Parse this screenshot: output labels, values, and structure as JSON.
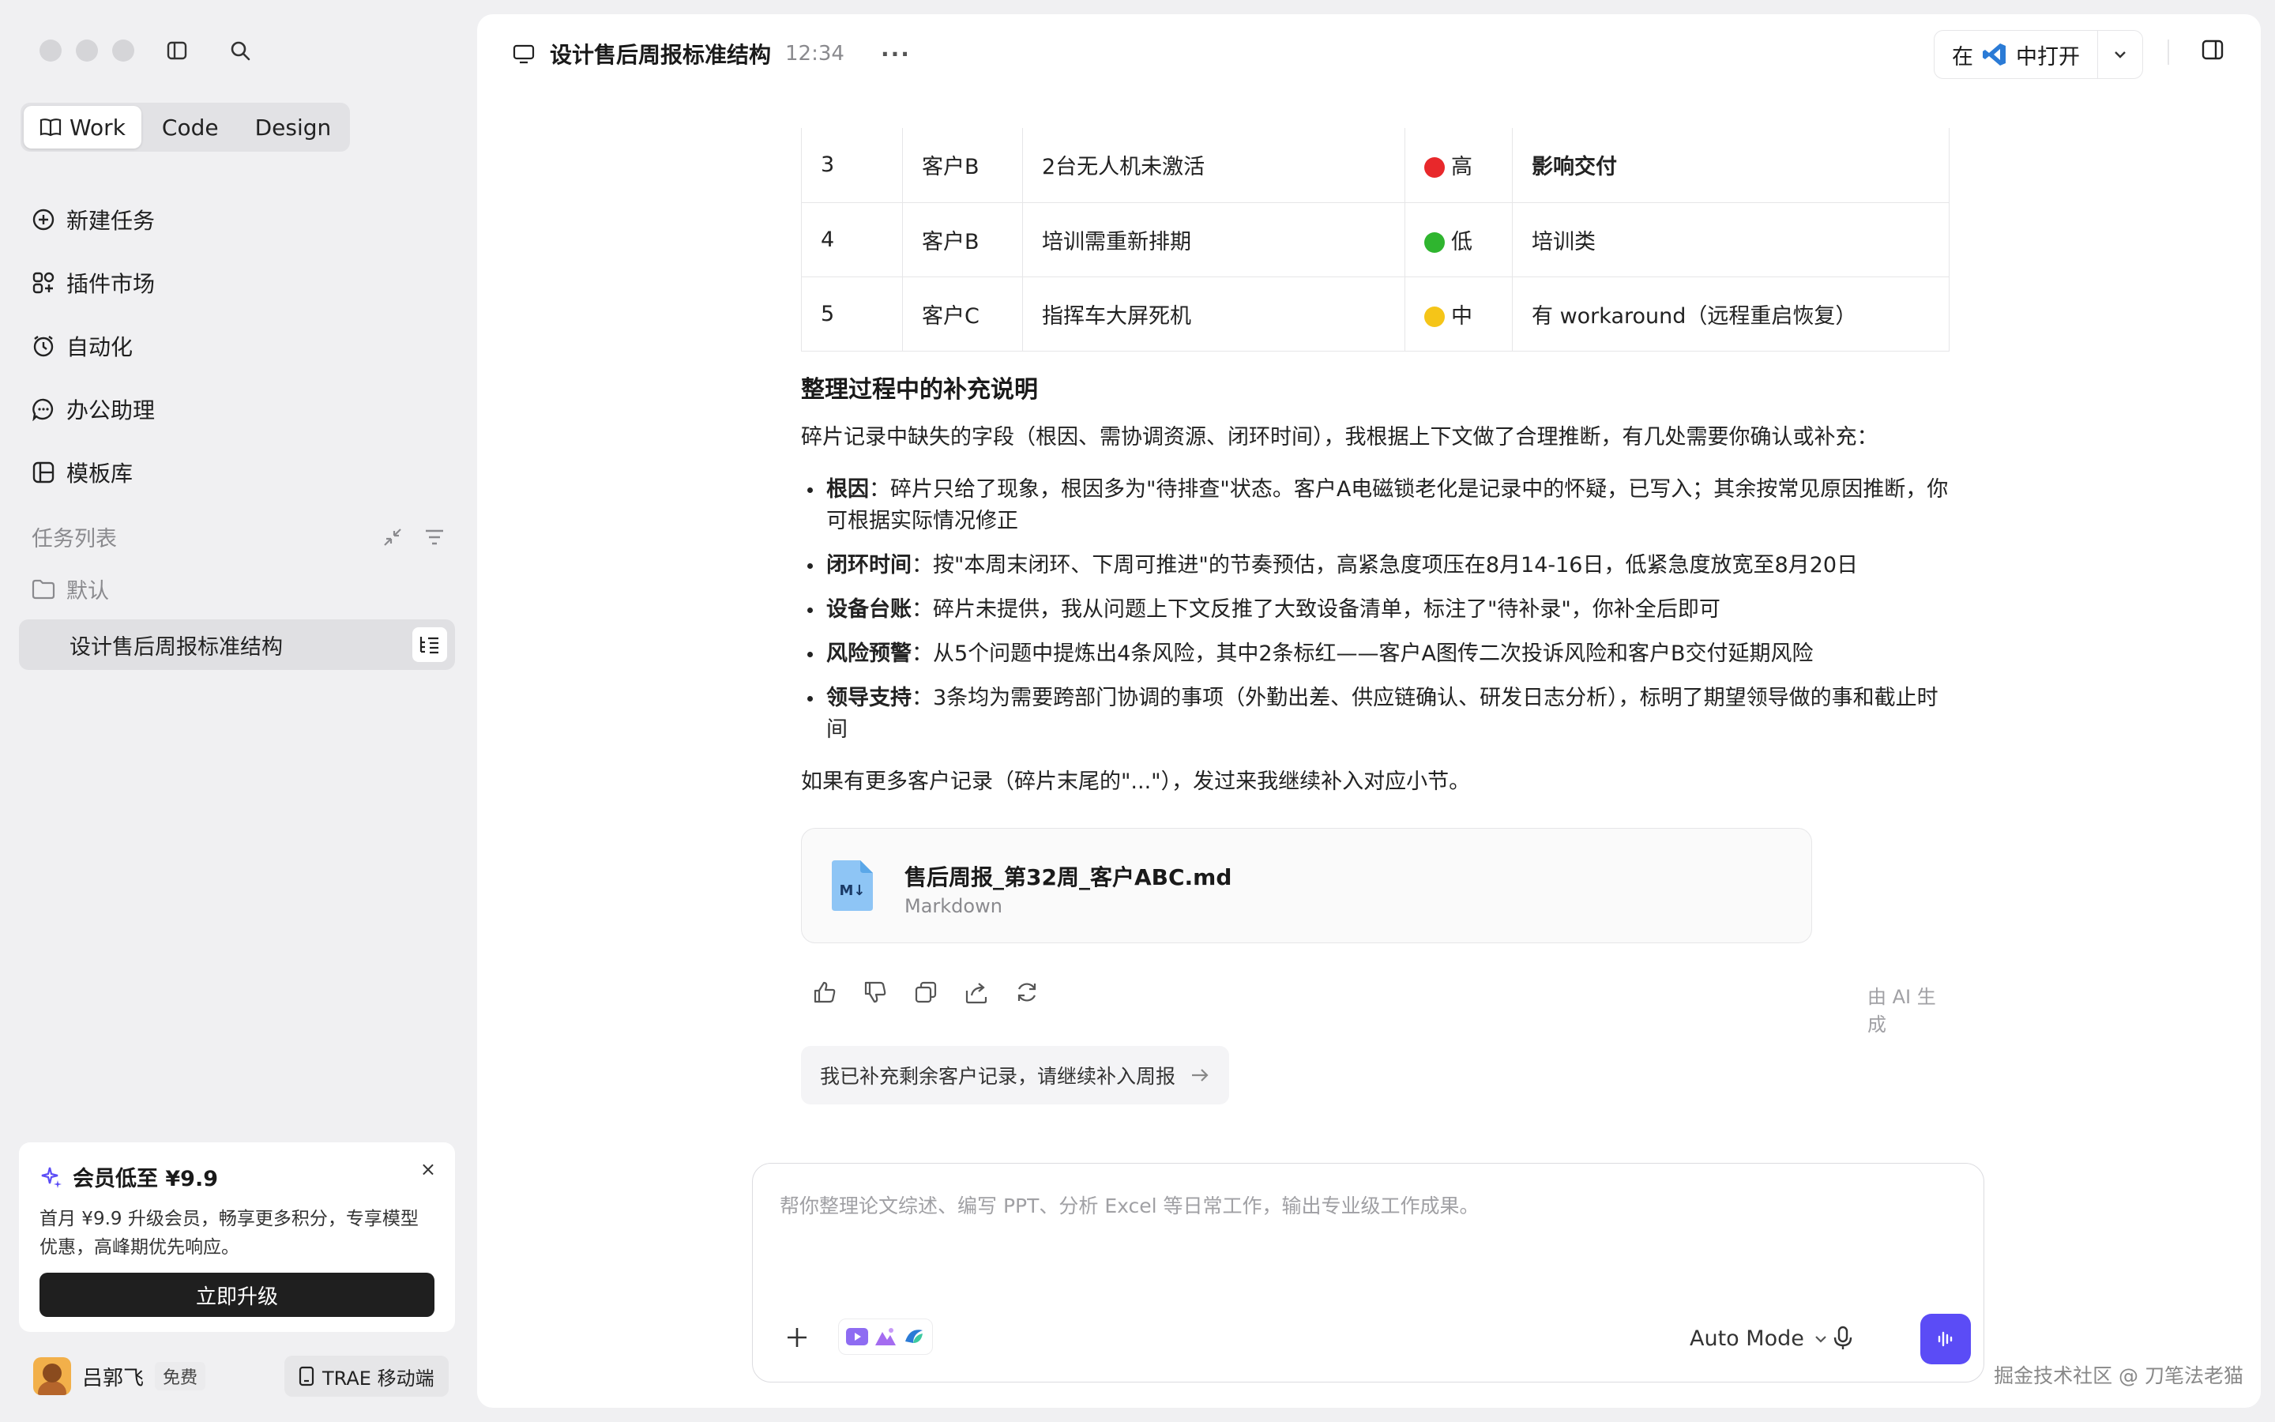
{
  "sidebar": {
    "modes": [
      {
        "label": "Work",
        "active": true
      },
      {
        "label": "Code",
        "active": false
      },
      {
        "label": "Design",
        "active": false
      }
    ],
    "nav": [
      {
        "label": "新建任务",
        "icon": "plus-circle-icon"
      },
      {
        "label": "插件市场",
        "icon": "plugin-grid-icon"
      },
      {
        "label": "自动化",
        "icon": "alarm-clock-icon"
      },
      {
        "label": "办公助理",
        "icon": "chat-bubble-icon"
      },
      {
        "label": "模板库",
        "icon": "template-icon"
      }
    ],
    "task_list_title": "任务列表",
    "folder_label": "默认",
    "active_task": "设计售后周报标准结构",
    "promo": {
      "title": "会员低至 ¥9.9",
      "desc": "首月 ¥9.9 升级会员，畅享更多积分，专享模型优惠，高峰期优先响应。",
      "button": "立即升级",
      "close": "×"
    },
    "user": {
      "name": "吕郭飞",
      "plan": "免费"
    },
    "mobile_button": "TRAE 移动端"
  },
  "header": {
    "title": "设计售后周报标准结构",
    "time": "12:34",
    "more": "···",
    "open_in_prefix": "在",
    "open_in_suffix": "中打开"
  },
  "table": {
    "rows": [
      {
        "no": "3",
        "customer": "客户B",
        "issue": "2台无人机未激活",
        "level": "高",
        "level_color": "#e8282b",
        "note": "影响交付",
        "note_bold": true
      },
      {
        "no": "4",
        "customer": "客户B",
        "issue": "培训需重新排期",
        "level": "低",
        "level_color": "#2fb52f",
        "note": "培训类",
        "note_bold": false
      },
      {
        "no": "5",
        "customer": "客户C",
        "issue": "指挥车大屏死机",
        "level": "中",
        "level_color": "#f5c518",
        "note": "有 workaround（远程重启恢复）",
        "note_bold": false
      }
    ]
  },
  "notes": {
    "title": "整理过程中的补充说明",
    "intro": "碎片记录中缺失的字段（根因、需协调资源、闭环时间），我根据上下文做了合理推断，有几处需要你确认或补充：",
    "bullets": [
      {
        "head": "根因",
        "text": "：碎片只给了现象，根因多为\"待排查\"状态。客户A电磁锁老化是记录中的怀疑，已写入；其余按常见原因推断，你可根据实际情况修正"
      },
      {
        "head": "闭环时间",
        "text": "：按\"本周末闭环、下周可推进\"的节奏预估，高紧急度项压在8月14-16日，低紧急度放宽至8月20日"
      },
      {
        "head": "设备台账",
        "text": "：碎片未提供，我从问题上下文反推了大致设备清单，标注了\"待补录\"，你补全后即可"
      },
      {
        "head": "风险预警",
        "text": "：从5个问题中提炼出4条风险，其中2条标红——客户A图传二次投诉风险和客户B交付延期风险"
      },
      {
        "head": "领导支持",
        "text": "：3条均为需要跨部门协调的事项（外勤出差、供应链确认、研发日志分析），标明了期望领导做的事和截止时间"
      }
    ],
    "outro": "如果有更多客户记录（碎片末尾的\"...\"），发过来我继续补入对应小节。"
  },
  "file": {
    "name": "售后周报_第32周_客户ABC.md",
    "type": "Markdown",
    "badge": "M↓"
  },
  "ai_generated": "由 AI 生成",
  "suggestion": "我已补充剩余客户记录，请继续补入周报",
  "composer": {
    "placeholder": "帮你整理论文综述、编写 PPT、分析 Excel 等日常工作，输出专业级工作成果。",
    "mode": "Auto Mode"
  },
  "watermark": "掘金技术社区 @ 刀笔法老猫",
  "colors": {
    "accent": "#5b4cf6",
    "vscode_blue": "#2b7bd6"
  }
}
